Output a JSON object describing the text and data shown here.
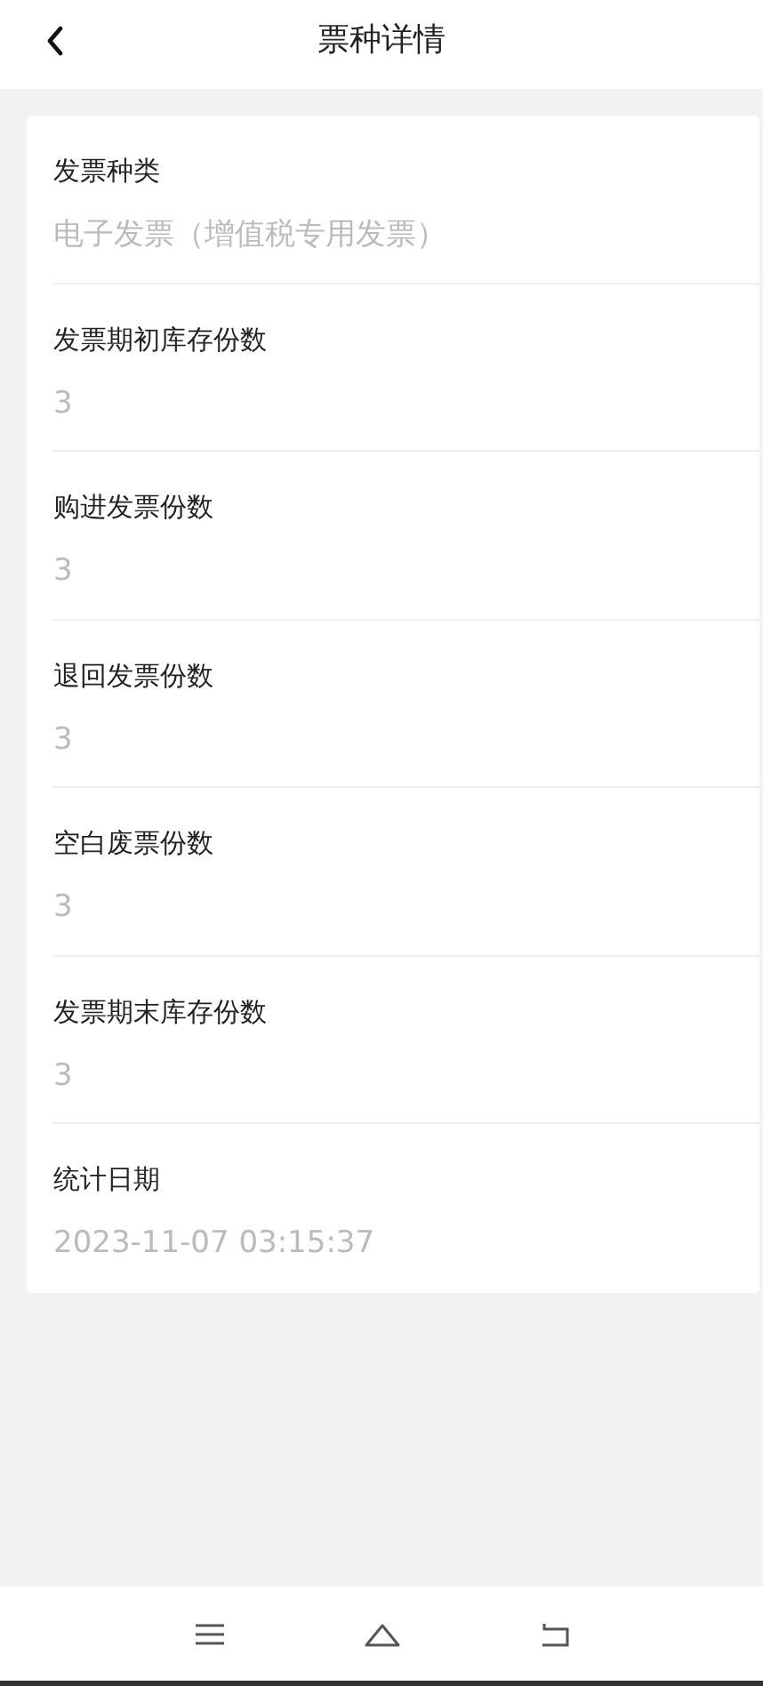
{
  "header": {
    "title": "票种详情"
  },
  "fields": [
    {
      "label": "发票种类",
      "value": "电子发票（增值税专用发票）"
    },
    {
      "label": "发票期初库存份数",
      "value": "3"
    },
    {
      "label": "购进发票份数",
      "value": "3"
    },
    {
      "label": "退回发票份数",
      "value": "3"
    },
    {
      "label": "空白废票份数",
      "value": "3"
    },
    {
      "label": "发票期末库存份数",
      "value": "3"
    },
    {
      "label": "统计日期",
      "value": "2023-11-07 03:15:37"
    }
  ]
}
